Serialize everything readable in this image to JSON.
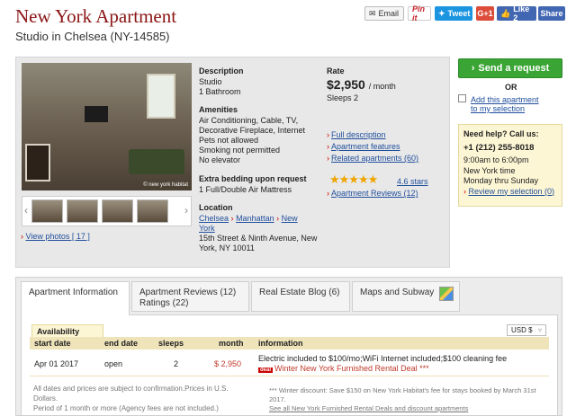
{
  "header": {
    "title": "New York Apartment",
    "subtitle": "Studio in Chelsea (NY-14585)"
  },
  "share": {
    "email": "Email",
    "pin": "Pin it",
    "tweet": "Tweet",
    "gplus": "G+1",
    "like": "Like 2",
    "share": "Share"
  },
  "photo": {
    "watermark": "© new york habitat",
    "view_photos": "View photos [ 17 ]"
  },
  "description": {
    "heading": "Description",
    "lines": [
      "Studio",
      "1 Bathroom"
    ]
  },
  "amenities": {
    "heading": "Amenities",
    "lines": [
      "Air Conditioning, Cable, TV,",
      "Decorative Fireplace, Internet",
      "Pets not allowed",
      "Smoking not permitted",
      "No elevator"
    ]
  },
  "bedding": {
    "heading": "Extra bedding upon request",
    "lines": [
      "1 Full/Double Air Mattress"
    ]
  },
  "location": {
    "heading": "Location",
    "crumb1": "Chelsea",
    "crumb2": "Manhattan",
    "crumb3": "New",
    "crumb3b": "York",
    "address1": "15th Street & Ninth Avenue, New",
    "address2": "York, NY 10011"
  },
  "rate": {
    "heading": "Rate",
    "amount": "$2,950",
    "per": "/ month",
    "sleeps": "Sleeps 2"
  },
  "links": [
    "Full description",
    "Apartment features",
    "Related apartments (60)"
  ],
  "rating": {
    "stars": 4.6,
    "score_text": "4.6 stars",
    "reviews": "Apartment Reviews (12)"
  },
  "side": {
    "send": "Send a request",
    "or": "OR",
    "add1": "Add this apartment",
    "add2": "to my selection",
    "help_heading": "Need help? Call us:",
    "phone": "+1 (212) 255-8018",
    "hours": "9:00am to 6:00pm",
    "tz": "New York time",
    "days": "Monday thru Sunday",
    "review": "Review my selection (0)"
  },
  "tabs": {
    "t1": "Apartment Information",
    "t2a": "Apartment Reviews (12)",
    "t2b": "Ratings (22)",
    "t3": "Real Estate Blog (6)",
    "t4": "Maps and Subway"
  },
  "availability": {
    "tab": "Availability",
    "currency": "USD $",
    "columns": [
      "start date",
      "end date",
      "sleeps",
      "month",
      "information"
    ],
    "row": {
      "start": "Apr 01 2017",
      "end": "open",
      "sleeps": "2",
      "month": "$ 2,950",
      "info1": "Electric included to $100/mo;WiFi Internet included;$100 cleaning fee",
      "deal_badge": "deal",
      "info2": "Winter New York Furnished Rental Deal ***"
    },
    "note_left_1": "All dates and prices are subject to confirmation.Prices in U.S. Dollars.",
    "note_left_2": "Period of 1 month or more (Agency fees are not included.)",
    "note_right_1": "*** Winter discount: Save $150 on New York Habitat's fee for stays booked by March 31st 2017.",
    "note_right_2": "See all New York Furnished Rental Deals and discount apartments"
  },
  "colors": {
    "title": "#8b1414",
    "send_button": "#3aa534",
    "link": "#1f4e9c",
    "price": "#c0392b"
  }
}
